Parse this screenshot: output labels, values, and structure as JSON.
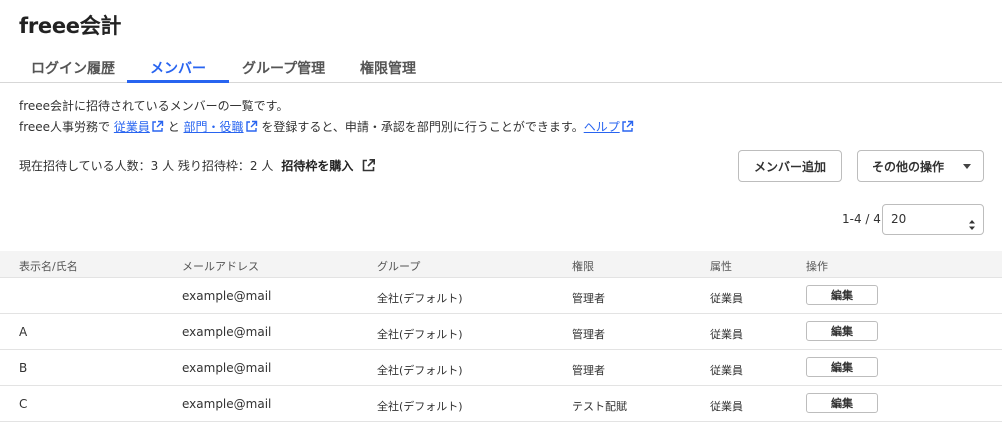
{
  "app": {
    "title": "freee会計"
  },
  "tabs": [
    {
      "label": "ログイン履歴",
      "active": false
    },
    {
      "label": "メンバー",
      "active": true
    },
    {
      "label": "グループ管理",
      "active": false
    },
    {
      "label": "権限管理",
      "active": false
    }
  ],
  "description": {
    "line1": "freee会計に招待されているメンバーの一覧です。",
    "line2_prefix": "freee人事労務で ",
    "employee_link": "従業員",
    "and_text": " と ",
    "dept_link": "部門・役職",
    "line2_middle": " を登録すると、申請・承認を部門別に行うことができます。",
    "help_link": "ヘルプ"
  },
  "invite": {
    "summary": "現在招待している人数：3 人 残り招待枠：2 人",
    "purchase_label": "招待枠を購入"
  },
  "buttons": {
    "add_member": "メンバー追加",
    "other_actions": "その他の操作"
  },
  "pager": {
    "count": "1-4 / 4",
    "page_size": "20"
  },
  "table": {
    "headers": {
      "name": "表示名/氏名",
      "email": "メールアドレス",
      "group": "グループ",
      "role": "権限",
      "attribute": "属性",
      "actions": "操作"
    },
    "rows": [
      {
        "name": "",
        "email": "example@mail",
        "group": "全社(デフォルト)",
        "role": "管理者",
        "attribute": "従業員",
        "action": "編集"
      },
      {
        "name": "A",
        "email": "example@mail",
        "group": "全社(デフォルト)",
        "role": "管理者",
        "attribute": "従業員",
        "action": "編集"
      },
      {
        "name": "B",
        "email": "example@mail",
        "group": "全社(デフォルト)",
        "role": "管理者",
        "attribute": "従業員",
        "action": "編集"
      },
      {
        "name": "C",
        "email": "example@mail",
        "group": "全社(デフォルト)",
        "role": "テスト配賦",
        "attribute": "従業員",
        "action": "編集"
      }
    ]
  },
  "colors": {
    "accent": "#2864f0",
    "text": "#323232",
    "header_bg": "#f4f4f4",
    "border": "#d7d7d7"
  },
  "icons": {
    "external_link": "external-link-icon",
    "dropdown_caret": "caret-down-icon",
    "select_updown": "select-updown-icon"
  }
}
